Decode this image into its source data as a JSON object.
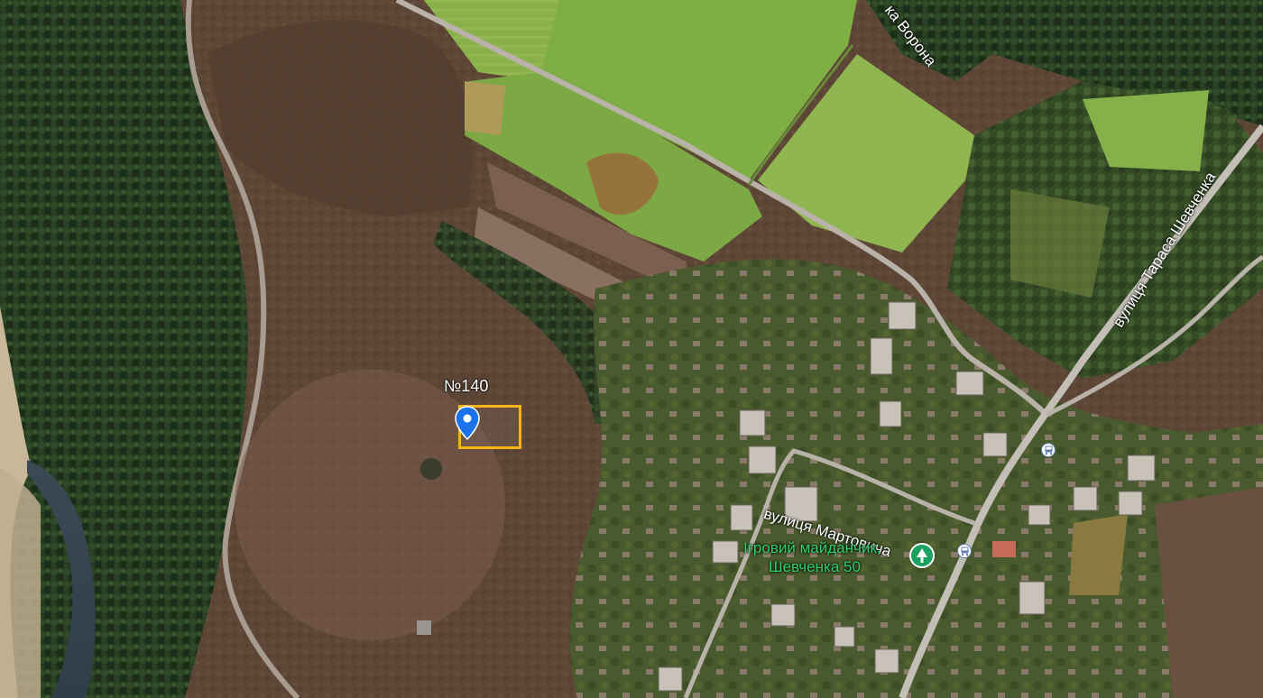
{
  "map": {
    "type": "satellite",
    "labels": {
      "river": "ка Ворона",
      "street_shevchenka": "вулиця Тараса Шевченка",
      "street_martovycha": "вулиця Мартовича",
      "plot": "№140"
    },
    "poi": {
      "name_line1": "Ігровий майданчик,",
      "name_line2": "Шевченка 50",
      "icon": "tree-icon",
      "color": "#1aa260"
    },
    "marker": {
      "icon": "location-pin-icon",
      "color": "#1a73e8"
    },
    "plot_outline_color": "#f6b419",
    "bus_stops": [
      {
        "icon": "bus-stop-icon"
      },
      {
        "icon": "bus-stop-icon"
      }
    ]
  }
}
